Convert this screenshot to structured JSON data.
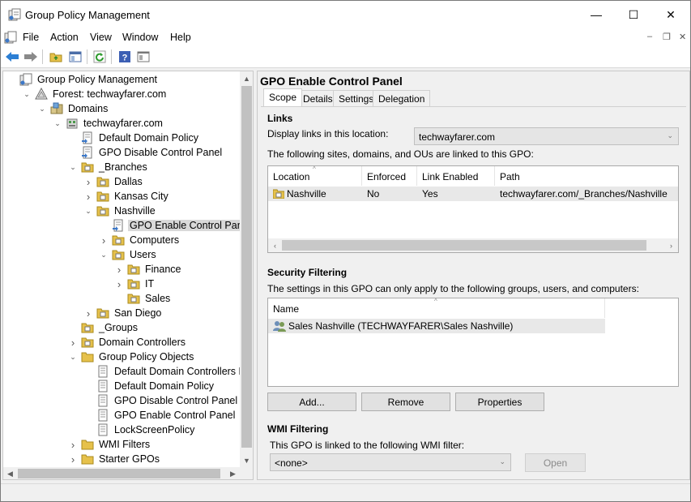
{
  "window": {
    "title": "Group Policy Management",
    "controls": {
      "minimize": "—",
      "maximize": "☐",
      "close": "✕"
    }
  },
  "menubar": {
    "items": [
      "File",
      "Action",
      "View",
      "Window",
      "Help"
    ],
    "mdi": {
      "minimize": "–",
      "restore": "❐",
      "close": "✕"
    }
  },
  "toolbar": {
    "buttons": [
      "back-icon",
      "forward-icon",
      "up-folder-icon",
      "show-hide-tree-icon",
      "refresh-icon",
      "help-icon",
      "properties-icon"
    ]
  },
  "tree": {
    "items": [
      {
        "label": "Group Policy Management",
        "icon": "gpm-icon",
        "depth": 0,
        "expand": ""
      },
      {
        "label": "Forest: techwayfarer.com",
        "icon": "forest-icon",
        "depth": 1,
        "expand": "v"
      },
      {
        "label": "Domains",
        "icon": "domains-icon",
        "depth": 2,
        "expand": "v"
      },
      {
        "label": "techwayfarer.com",
        "icon": "domain-icon",
        "depth": 3,
        "expand": "v"
      },
      {
        "label": "Default Domain Policy",
        "icon": "gpo-link-icon",
        "depth": 4,
        "expand": ""
      },
      {
        "label": "GPO Disable Control Panel",
        "icon": "gpo-link-icon",
        "depth": 4,
        "expand": ""
      },
      {
        "label": "_Branches",
        "icon": "ou-icon",
        "depth": 4,
        "expand": "v"
      },
      {
        "label": "Dallas",
        "icon": "ou-icon",
        "depth": 5,
        "expand": ">"
      },
      {
        "label": "Kansas City",
        "icon": "ou-icon",
        "depth": 5,
        "expand": ">"
      },
      {
        "label": "Nashville",
        "icon": "ou-icon",
        "depth": 5,
        "expand": "v"
      },
      {
        "label": "GPO Enable Control Panel",
        "icon": "gpo-link-icon",
        "depth": 6,
        "expand": "",
        "selected": true
      },
      {
        "label": "Computers",
        "icon": "ou-icon",
        "depth": 6,
        "expand": ">"
      },
      {
        "label": "Users",
        "icon": "ou-icon",
        "depth": 6,
        "expand": "v"
      },
      {
        "label": "Finance",
        "icon": "ou-icon",
        "depth": 7,
        "expand": ">"
      },
      {
        "label": "IT",
        "icon": "ou-icon",
        "depth": 7,
        "expand": ">"
      },
      {
        "label": "Sales",
        "icon": "ou-icon",
        "depth": 7,
        "expand": ""
      },
      {
        "label": "San Diego",
        "icon": "ou-icon",
        "depth": 5,
        "expand": ">"
      },
      {
        "label": "_Groups",
        "icon": "ou-icon",
        "depth": 4,
        "expand": ""
      },
      {
        "label": "Domain Controllers",
        "icon": "ou-icon",
        "depth": 4,
        "expand": ">"
      },
      {
        "label": "Group Policy Objects",
        "icon": "folder-icon",
        "depth": 4,
        "expand": "v"
      },
      {
        "label": "Default Domain Controllers Policy",
        "icon": "gpo-icon",
        "depth": 5,
        "expand": ""
      },
      {
        "label": "Default Domain Policy",
        "icon": "gpo-icon",
        "depth": 5,
        "expand": ""
      },
      {
        "label": "GPO Disable Control Panel",
        "icon": "gpo-icon",
        "depth": 5,
        "expand": ""
      },
      {
        "label": "GPO Enable Control Panel",
        "icon": "gpo-icon",
        "depth": 5,
        "expand": ""
      },
      {
        "label": "LockScreenPolicy",
        "icon": "gpo-icon",
        "depth": 5,
        "expand": ""
      },
      {
        "label": "WMI Filters",
        "icon": "folder-icon",
        "depth": 4,
        "expand": ">"
      },
      {
        "label": "Starter GPOs",
        "icon": "folder-icon",
        "depth": 4,
        "expand": ">"
      }
    ]
  },
  "details": {
    "title": "GPO Enable Control Panel",
    "tabs": [
      "Scope",
      "Details",
      "Settings",
      "Delegation"
    ],
    "links": {
      "header": "Links",
      "display_label": "Display links in this location:",
      "location_value": "techwayfarer.com",
      "description": "The following sites, domains, and OUs are linked to this GPO:",
      "columns": [
        "Location",
        "Enforced",
        "Link Enabled",
        "Path"
      ],
      "rows": [
        {
          "location": "Nashville",
          "enforced": "No",
          "link_enabled": "Yes",
          "path": "techwayfarer.com/_Branches/Nashville"
        }
      ]
    },
    "security": {
      "header": "Security Filtering",
      "description": "The settings in this GPO can only apply to the following groups, users, and computers:",
      "columns": [
        "Name"
      ],
      "rows": [
        {
          "name": "Sales Nashville (TECHWAYFARER\\Sales Nashville)"
        }
      ],
      "buttons": {
        "add": "Add...",
        "remove": "Remove",
        "properties": "Properties"
      }
    },
    "wmi": {
      "header": "WMI Filtering",
      "description": "This GPO is linked to the following WMI filter:",
      "filter_value": "<none>",
      "open_button": "Open"
    }
  }
}
